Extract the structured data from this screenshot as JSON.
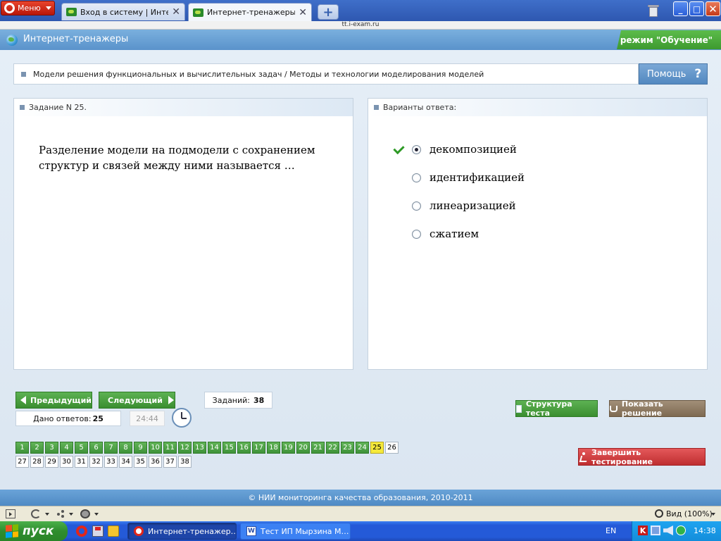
{
  "browser": {
    "menu_label": "Меню",
    "tabs": [
      {
        "title": "Вход в систему | Интер…",
        "active": false
      },
      {
        "title": "Интернет-тренажеры",
        "active": true
      }
    ],
    "tab_close_glyph": "✕",
    "new_tab_glyph": "+",
    "address": "tt.i-exam.ru",
    "window_controls": {
      "minimize": "_",
      "maximize": "□",
      "close": "✕"
    }
  },
  "site": {
    "title": "Интернет-тренажеры",
    "mode": "режим \"Обучение\"",
    "topic": "Модели решения функциональных и вычислительных задач / Методы и технологии моделирования моделей",
    "help_label": "Помощь",
    "help_glyph": "?"
  },
  "question": {
    "header": "Задание N 25.",
    "text": "Разделение модели на подмодели с сохранением структур и связей между ними называется …"
  },
  "answers": {
    "header": "Варианты ответа:",
    "options": [
      {
        "label": "декомпозицией",
        "selected": true,
        "correct_mark": true
      },
      {
        "label": "идентификацией",
        "selected": false,
        "correct_mark": false
      },
      {
        "label": "линеаризацией",
        "selected": false,
        "correct_mark": false
      },
      {
        "label": "сжатием",
        "selected": false,
        "correct_mark": false
      }
    ]
  },
  "navigation": {
    "prev_label": "Предыдущий",
    "next_label": "Следующий",
    "tasks_label": "Заданий:",
    "tasks_total": "38",
    "answered_label": "Дано ответов:",
    "answered_count": "25",
    "timer": "24:44"
  },
  "actions": {
    "structure_label": "Структура теста",
    "show_solution_label": "Показать решение",
    "finish_label": "Завершить тестирование"
  },
  "question_grid": {
    "answered_count": 24,
    "current": 25,
    "total": 38,
    "colors": {
      "done": "#4ea445",
      "current": "#f5e93a",
      "todo": "#ffffff"
    }
  },
  "footer": {
    "copyright": "© НИИ мониторинга качества образования, 2010-2011"
  },
  "statusbar": {
    "zoom": "Вид (100%)"
  },
  "taskbar": {
    "start_label": "пуск",
    "tasks": [
      {
        "title": "Интернет-тренажер…",
        "active": true,
        "icon": "opera-icon"
      },
      {
        "title": "Тест ИП Мырзина М…",
        "active": false,
        "icon": "word-icon"
      }
    ],
    "lang": "EN",
    "kav_glyph": "K",
    "time": "14:38"
  }
}
